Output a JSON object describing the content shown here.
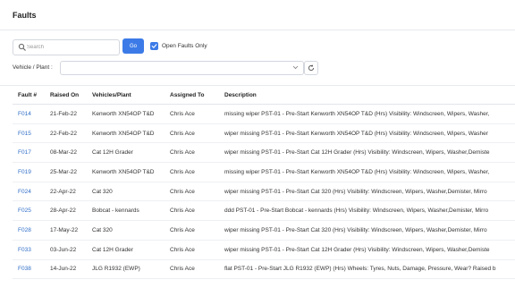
{
  "page": {
    "title": "Faults"
  },
  "search": {
    "placeholder": "Search",
    "go_label": "Go"
  },
  "filter": {
    "open_only_label": "Open Faults Only",
    "open_only_checked": true
  },
  "plant_filter": {
    "label": "Vehicle / Plant :",
    "value": ""
  },
  "table": {
    "columns": [
      "Fault #",
      "Raised On",
      "Vehicles/Plant",
      "Assigned To",
      "Description"
    ],
    "rows": [
      [
        "F014",
        "21-Feb-22",
        "Kenworth XN54OP T&D",
        "Chris Ace",
        "missing wiper PST-01 - Pre-Start Kenworth XN54OP T&D (Hrs) Visibility: Windscreen, Wipers, Washer,"
      ],
      [
        "F015",
        "22-Feb-22",
        "Kenworth XN54OP T&D",
        "Chris Ace",
        "wiper missing  PST-01 - Pre-Start Kenworth XN54OP T&D (Hrs) Visibility: Windscreen, Wipers, Washer"
      ],
      [
        "F017",
        "08-Mar-22",
        "Cat 12H Grader",
        "Chris Ace",
        "wiper missing PST-01 - Pre-Start Cat 12H Grader (Hrs) Visibility: Windscreen, Wipers, Washer,Demiste"
      ],
      [
        "F019",
        "25-Mar-22",
        "Kenworth XN54OP T&D",
        "Chris Ace",
        "missing wiper PST-01 - Pre-Start Kenworth XN54OP T&D (Hrs) Visibility: Windscreen, Wipers, Washer,"
      ],
      [
        "F024",
        "22-Apr-22",
        "Cat 320",
        "Chris Ace",
        "wiper missing PST-01 - Pre-Start Cat 320 (Hrs) Visibility: Windscreen, Wipers, Washer,Demister, Mirro"
      ],
      [
        "F025",
        "28-Apr-22",
        "Bobcat - kennards",
        "Chris Ace",
        "ddd PST-01 - Pre-Start Bobcat - kennards (Hrs) Visibility: Windscreen, Wipers, Washer,Demister, Mirro"
      ],
      [
        "F028",
        "17-May-22",
        "Cat 320",
        "Chris Ace",
        "wiper missing PST-01 - Pre-Start Cat 320 (Hrs) Visibility: Windscreen, Wipers, Washer,Demister, Mirro"
      ],
      [
        "F033",
        "03-Jun-22",
        "Cat 12H Grader",
        "Chris Ace",
        "wiper missing PST-01 - Pre-Start Cat 12H Grader (Hrs) Visibility: Windscreen, Wipers, Washer,Demiste"
      ],
      [
        "F038",
        "14-Jun-22",
        "JLG R1932 (EWP)",
        "Chris Ace",
        "flat PST-01 - Pre-Start JLG R1932 (EWP) (Hrs) Wheels: Tyres, Nuts, Damage, Pressure, Wear? Raised b"
      ]
    ]
  },
  "colors": {
    "accent": "#3c7be7",
    "link": "#2f6ec8"
  },
  "icons": [
    "search-icon",
    "check-icon",
    "chevron-down-icon",
    "refresh-icon"
  ]
}
